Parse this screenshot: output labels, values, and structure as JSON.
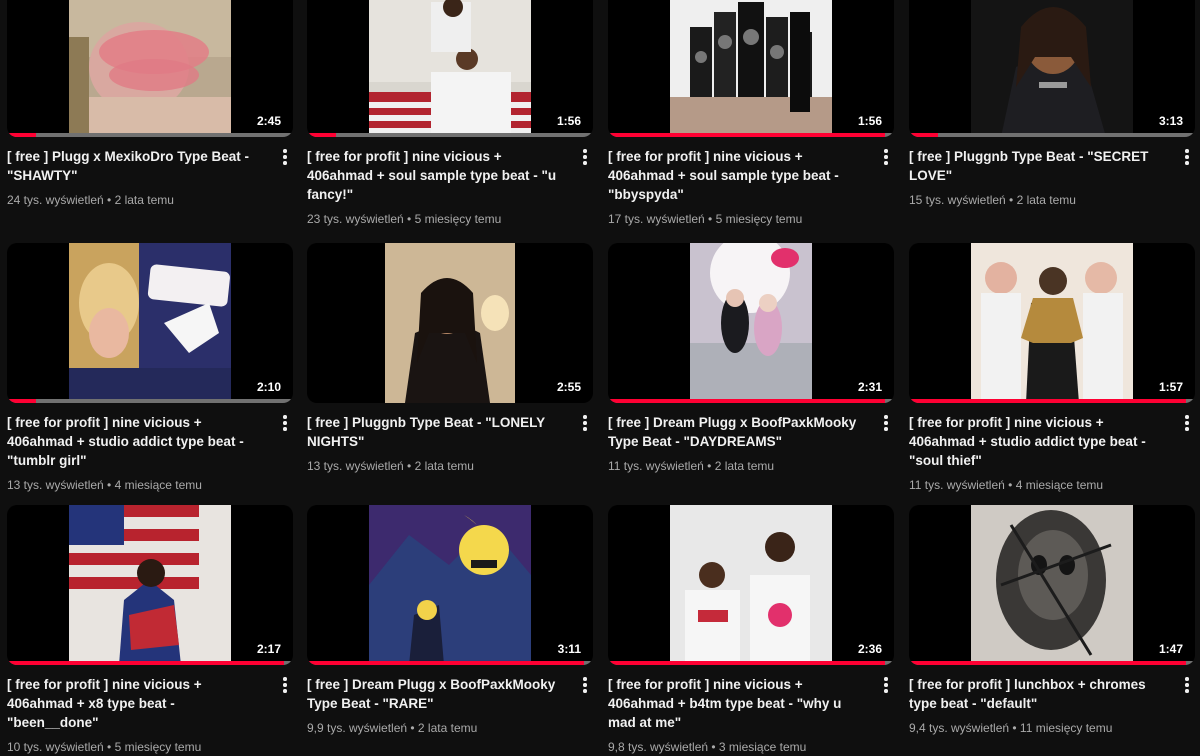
{
  "colors": {
    "background": "#0f0f0f",
    "progress": "#ff0033",
    "text": "#f1f1f1",
    "secondary": "#aaaaaa"
  },
  "videos": [
    {
      "title": "[ free ] Plugg x MexikoDro Type Beat - \"SHAWTY\"",
      "views": "24 tys. wyświetleń",
      "age": "2 lata temu",
      "duration": "2:45",
      "watched_fraction": 0.1
    },
    {
      "title": "[ free for profit ] nine vicious + 406ahmad + soul sample type beat - \"u fancy!\"",
      "views": "23 tys. wyświetleń",
      "age": "5 miesięcy temu",
      "duration": "1:56",
      "watched_fraction": 0.1
    },
    {
      "title": "[ free for profit ] nine vicious + 406ahmad + soul sample type beat - \"bbyspyda\"",
      "views": "17 tys. wyświetleń",
      "age": "5 miesięcy temu",
      "duration": "1:56",
      "watched_fraction": 0.97
    },
    {
      "title": "[ free ] Pluggnb Type Beat - \"SECRET LOVE\"",
      "views": "15 tys. wyświetleń",
      "age": "2 lata temu",
      "duration": "3:13",
      "watched_fraction": 0.1
    },
    {
      "title": "[ free for profit ] nine vicious + 406ahmad + studio addict type beat - \"tumblr girl\"",
      "views": "13 tys. wyświetleń",
      "age": "4 miesiące temu",
      "duration": "2:10",
      "watched_fraction": 0.1
    },
    {
      "title": "[ free ] Pluggnb Type Beat - \"LONELY NIGHTS\"",
      "views": "13 tys. wyświetleń",
      "age": "2 lata temu",
      "duration": "2:55",
      "watched_fraction": 0
    },
    {
      "title": "[ free ] Dream Plugg x BoofPaxkMooky Type Beat - \"DAYDREAMS\"",
      "views": "11 tys. wyświetleń",
      "age": "2 lata temu",
      "duration": "2:31",
      "watched_fraction": 0.97
    },
    {
      "title": "[ free for profit ] nine vicious + 406ahmad + studio addict type beat - \"soul thief\"",
      "views": "11 tys. wyświetleń",
      "age": "4 miesiące temu",
      "duration": "1:57",
      "watched_fraction": 0.97
    },
    {
      "title": "[ free for profit ] nine vicious + 406ahmad + x8 type beat - \"been__done\"",
      "views": "10 tys. wyświetleń",
      "age": "5 miesięcy temu",
      "duration": "2:17",
      "watched_fraction": 0.97
    },
    {
      "title": "[ free ] Dream Plugg x BoofPaxkMooky Type Beat - \"RARE\"",
      "views": "9,9 tys. wyświetleń",
      "age": "2 lata temu",
      "duration": "3:11",
      "watched_fraction": 0.97
    },
    {
      "title": "[ free for profit ] nine vicious + 406ahmad + b4tm type beat - \"why u mad at me\"",
      "views": "9,8 tys. wyświetleń",
      "age": "3 miesiące temu",
      "duration": "2:36",
      "watched_fraction": 0.97
    },
    {
      "title": "[ free for profit ] lunchbox + chromes type beat - \"default\"",
      "views": "9,4 tys. wyświetleń",
      "age": "11 miesięcy temu",
      "duration": "1:47",
      "watched_fraction": 0.97
    }
  ]
}
